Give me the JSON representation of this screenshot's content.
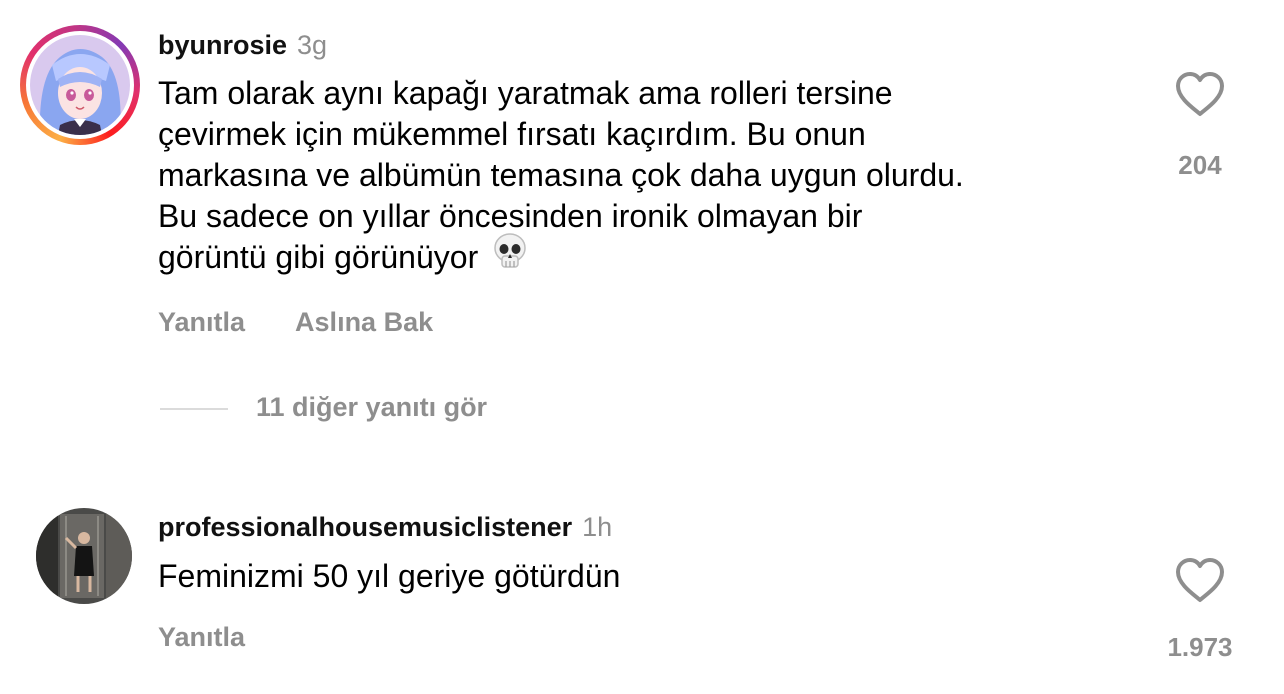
{
  "comments": [
    {
      "username": "byunrosie",
      "time": "3g",
      "text_lines": [
        "Tam olarak aynı kapağı yaratmak ama rolleri tersine",
        "çevirmek için mükemmel fırsatı kaçırdım. Bu onun",
        "markasına ve albümün temasına çok daha uygun olurdu.",
        "Bu sadece on yıllar öncesinden ironik olmayan bir",
        "görüntü gibi görünüyor"
      ],
      "emoji": "skull-emoji",
      "likes": "204",
      "reply_label": "Yanıtla",
      "translate_label": "Aslına Bak",
      "view_replies": "11 diğer yanıtı gör",
      "has_story_ring": true
    },
    {
      "username": "professionalhousemusiclistener",
      "time": "1h",
      "text_lines": [
        "Feminizmi 50 yıl geriye götürdün"
      ],
      "likes": "1.973",
      "reply_label": "Yanıtla",
      "has_story_ring": false
    }
  ],
  "icons": {
    "like": "heart-outline-icon"
  },
  "colors": {
    "secondary_text": "#8e8e8e",
    "story_ring_start": "#fcaf45",
    "story_ring_end": "#c13584"
  }
}
